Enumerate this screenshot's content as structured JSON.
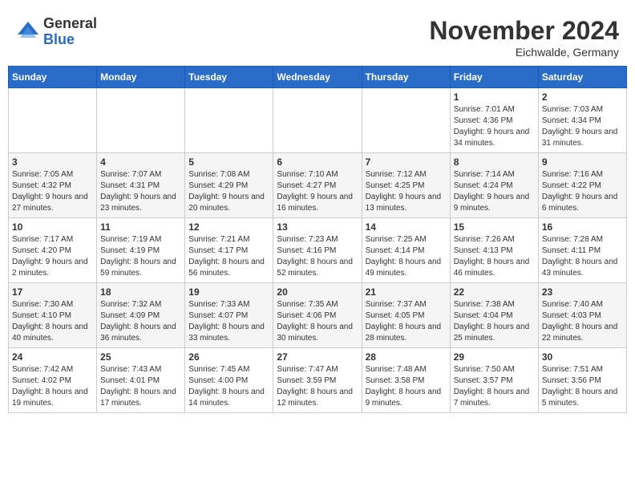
{
  "header": {
    "logo_general": "General",
    "logo_blue": "Blue",
    "month_title": "November 2024",
    "location": "Eichwalde, Germany"
  },
  "days_of_week": [
    "Sunday",
    "Monday",
    "Tuesday",
    "Wednesday",
    "Thursday",
    "Friday",
    "Saturday"
  ],
  "weeks": [
    [
      {
        "day": "",
        "info": ""
      },
      {
        "day": "",
        "info": ""
      },
      {
        "day": "",
        "info": ""
      },
      {
        "day": "",
        "info": ""
      },
      {
        "day": "",
        "info": ""
      },
      {
        "day": "1",
        "info": "Sunrise: 7:01 AM\nSunset: 4:36 PM\nDaylight: 9 hours and 34 minutes."
      },
      {
        "day": "2",
        "info": "Sunrise: 7:03 AM\nSunset: 4:34 PM\nDaylight: 9 hours and 31 minutes."
      }
    ],
    [
      {
        "day": "3",
        "info": "Sunrise: 7:05 AM\nSunset: 4:32 PM\nDaylight: 9 hours and 27 minutes."
      },
      {
        "day": "4",
        "info": "Sunrise: 7:07 AM\nSunset: 4:31 PM\nDaylight: 9 hours and 23 minutes."
      },
      {
        "day": "5",
        "info": "Sunrise: 7:08 AM\nSunset: 4:29 PM\nDaylight: 9 hours and 20 minutes."
      },
      {
        "day": "6",
        "info": "Sunrise: 7:10 AM\nSunset: 4:27 PM\nDaylight: 9 hours and 16 minutes."
      },
      {
        "day": "7",
        "info": "Sunrise: 7:12 AM\nSunset: 4:25 PM\nDaylight: 9 hours and 13 minutes."
      },
      {
        "day": "8",
        "info": "Sunrise: 7:14 AM\nSunset: 4:24 PM\nDaylight: 9 hours and 9 minutes."
      },
      {
        "day": "9",
        "info": "Sunrise: 7:16 AM\nSunset: 4:22 PM\nDaylight: 9 hours and 6 minutes."
      }
    ],
    [
      {
        "day": "10",
        "info": "Sunrise: 7:17 AM\nSunset: 4:20 PM\nDaylight: 9 hours and 2 minutes."
      },
      {
        "day": "11",
        "info": "Sunrise: 7:19 AM\nSunset: 4:19 PM\nDaylight: 8 hours and 59 minutes."
      },
      {
        "day": "12",
        "info": "Sunrise: 7:21 AM\nSunset: 4:17 PM\nDaylight: 8 hours and 56 minutes."
      },
      {
        "day": "13",
        "info": "Sunrise: 7:23 AM\nSunset: 4:16 PM\nDaylight: 8 hours and 52 minutes."
      },
      {
        "day": "14",
        "info": "Sunrise: 7:25 AM\nSunset: 4:14 PM\nDaylight: 8 hours and 49 minutes."
      },
      {
        "day": "15",
        "info": "Sunrise: 7:26 AM\nSunset: 4:13 PM\nDaylight: 8 hours and 46 minutes."
      },
      {
        "day": "16",
        "info": "Sunrise: 7:28 AM\nSunset: 4:11 PM\nDaylight: 8 hours and 43 minutes."
      }
    ],
    [
      {
        "day": "17",
        "info": "Sunrise: 7:30 AM\nSunset: 4:10 PM\nDaylight: 8 hours and 40 minutes."
      },
      {
        "day": "18",
        "info": "Sunrise: 7:32 AM\nSunset: 4:09 PM\nDaylight: 8 hours and 36 minutes."
      },
      {
        "day": "19",
        "info": "Sunrise: 7:33 AM\nSunset: 4:07 PM\nDaylight: 8 hours and 33 minutes."
      },
      {
        "day": "20",
        "info": "Sunrise: 7:35 AM\nSunset: 4:06 PM\nDaylight: 8 hours and 30 minutes."
      },
      {
        "day": "21",
        "info": "Sunrise: 7:37 AM\nSunset: 4:05 PM\nDaylight: 8 hours and 28 minutes."
      },
      {
        "day": "22",
        "info": "Sunrise: 7:38 AM\nSunset: 4:04 PM\nDaylight: 8 hours and 25 minutes."
      },
      {
        "day": "23",
        "info": "Sunrise: 7:40 AM\nSunset: 4:03 PM\nDaylight: 8 hours and 22 minutes."
      }
    ],
    [
      {
        "day": "24",
        "info": "Sunrise: 7:42 AM\nSunset: 4:02 PM\nDaylight: 8 hours and 19 minutes."
      },
      {
        "day": "25",
        "info": "Sunrise: 7:43 AM\nSunset: 4:01 PM\nDaylight: 8 hours and 17 minutes."
      },
      {
        "day": "26",
        "info": "Sunrise: 7:45 AM\nSunset: 4:00 PM\nDaylight: 8 hours and 14 minutes."
      },
      {
        "day": "27",
        "info": "Sunrise: 7:47 AM\nSunset: 3:59 PM\nDaylight: 8 hours and 12 minutes."
      },
      {
        "day": "28",
        "info": "Sunrise: 7:48 AM\nSunset: 3:58 PM\nDaylight: 8 hours and 9 minutes."
      },
      {
        "day": "29",
        "info": "Sunrise: 7:50 AM\nSunset: 3:57 PM\nDaylight: 8 hours and 7 minutes."
      },
      {
        "day": "30",
        "info": "Sunrise: 7:51 AM\nSunset: 3:56 PM\nDaylight: 8 hours and 5 minutes."
      }
    ]
  ]
}
